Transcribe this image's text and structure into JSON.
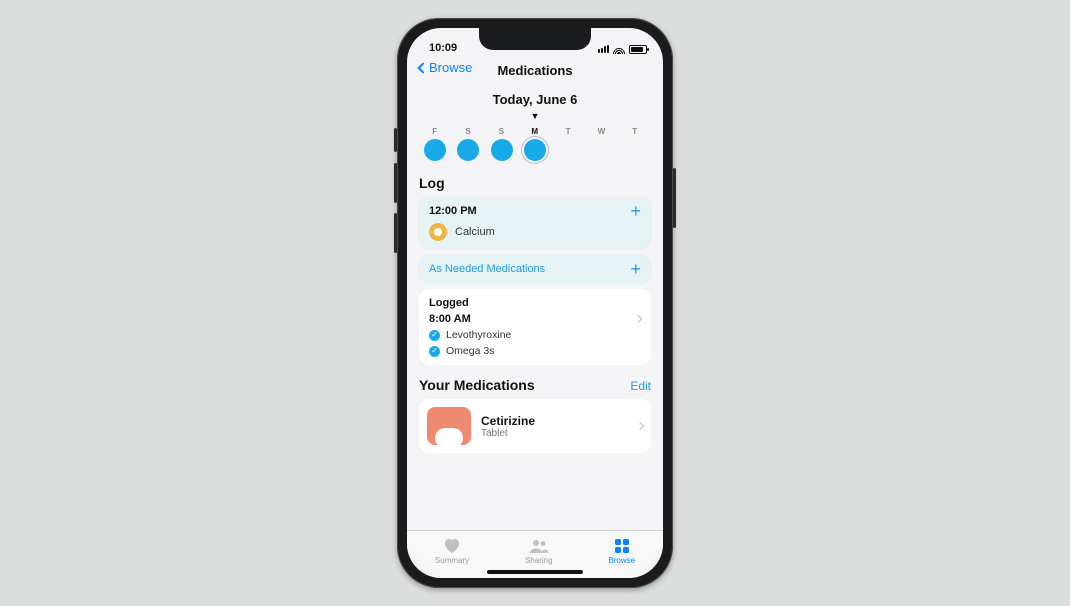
{
  "status": {
    "time": "10:09"
  },
  "nav": {
    "back_label": "Browse",
    "title": "Medications"
  },
  "date_header": "Today, June 6",
  "week": {
    "days": [
      {
        "label": "F",
        "state": "filled"
      },
      {
        "label": "S",
        "state": "filled"
      },
      {
        "label": "S",
        "state": "filled"
      },
      {
        "label": "M",
        "state": "today"
      },
      {
        "label": "T",
        "state": "empty"
      },
      {
        "label": "W",
        "state": "empty"
      },
      {
        "label": "T",
        "state": "empty"
      }
    ]
  },
  "log": {
    "section_title": "Log",
    "upcoming": {
      "time": "12:00 PM",
      "items": [
        {
          "name": "Calcium"
        }
      ]
    },
    "as_needed_label": "As Needed Medications",
    "logged_title": "Logged",
    "logged": {
      "time": "8:00 AM",
      "items": [
        {
          "name": "Levothyroxine"
        },
        {
          "name": "Omega 3s"
        }
      ]
    }
  },
  "your_meds": {
    "title": "Your Medications",
    "edit_label": "Edit",
    "items": [
      {
        "name": "Cetirizine",
        "form": "Tablet"
      }
    ]
  },
  "tabs": {
    "items": [
      {
        "label": "Summary"
      },
      {
        "label": "Sharing"
      },
      {
        "label": "Browse"
      }
    ]
  }
}
